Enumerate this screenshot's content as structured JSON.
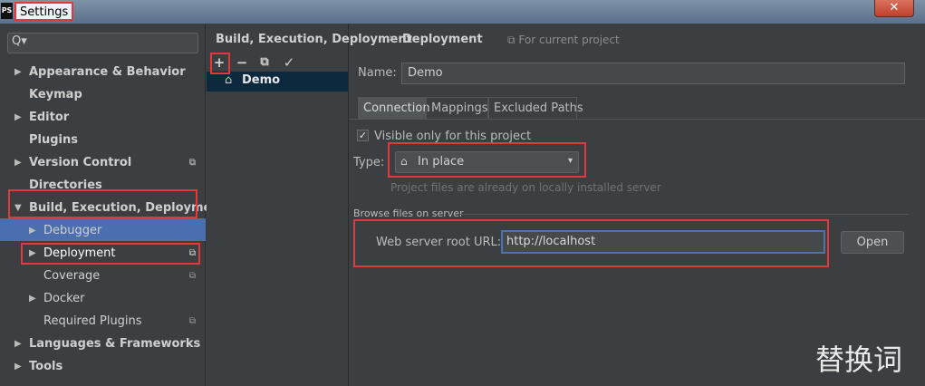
{
  "window": {
    "app_icon": "PS",
    "title": "Settings",
    "close_glyph": "✕"
  },
  "sidebar": {
    "search_icon": "search-icon",
    "search_glyph": "Q▾",
    "items": [
      {
        "label": "Appearance & Behavior",
        "arrow": "▶"
      },
      {
        "label": "Keymap",
        "arrow": ""
      },
      {
        "label": "Editor",
        "arrow": "▶"
      },
      {
        "label": "Plugins",
        "arrow": ""
      },
      {
        "label": "Version Control",
        "arrow": "▶"
      },
      {
        "label": "Directories",
        "arrow": ""
      },
      {
        "label": "Build, Execution, Deployment",
        "arrow": "▼"
      },
      {
        "label": "Debugger",
        "arrow": "▶"
      },
      {
        "label": "Deployment",
        "arrow": "▶"
      },
      {
        "label": "Coverage",
        "arrow": ""
      },
      {
        "label": "Docker",
        "arrow": "▶"
      },
      {
        "label": "Required Plugins",
        "arrow": ""
      },
      {
        "label": "Languages & Frameworks",
        "arrow": "▶"
      },
      {
        "label": "Tools",
        "arrow": "▶"
      }
    ],
    "copy_glyph": "⧉"
  },
  "toolbar": {
    "add": "+",
    "remove": "−",
    "copy": "⧉",
    "apply": "✓"
  },
  "servers": {
    "home_glyph": "⌂",
    "selected": "Demo"
  },
  "breadcrumb": {
    "parent": "Build, Execution, Deployment",
    "separator": "›",
    "current": "Deployment",
    "scope_glyph": "⧉",
    "scope": "For current project"
  },
  "form": {
    "name_label": "Name:",
    "name_value": "Demo",
    "tabs": [
      "Connection",
      "Mappings",
      "Excluded Paths"
    ],
    "visible_only_label": "Visible only for this project",
    "visible_only_checked": "✓",
    "type_label": "Type:",
    "type_value": "In place",
    "type_caret": "▾",
    "type_hint": "Project files are already on locally installed server",
    "browse_section": "Browse files on server",
    "url_label": "Web server root URL:",
    "url_value": "http://localhost",
    "open_button": "Open"
  },
  "watermark": "替换词",
  "colors": {
    "selection": "#4b6eaf",
    "highlight_box": "#e0393e",
    "panel_bg": "#3c3f41"
  }
}
